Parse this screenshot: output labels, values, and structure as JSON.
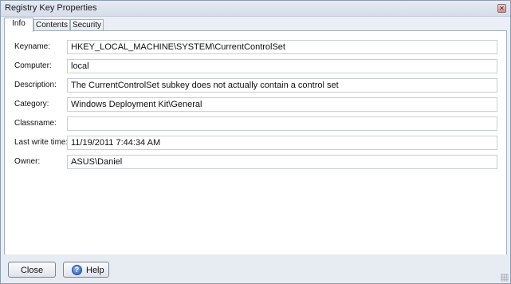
{
  "window": {
    "title": "Registry Key Properties"
  },
  "tabs": [
    {
      "label": "Info",
      "active": true
    },
    {
      "label": "Contents",
      "active": false
    },
    {
      "label": "Security",
      "active": false
    }
  ],
  "fields": [
    {
      "label": "Keyname:",
      "value": "HKEY_LOCAL_MACHINE\\SYSTEM\\CurrentControlSet"
    },
    {
      "label": "Computer:",
      "value": "local"
    },
    {
      "label": "Description:",
      "value": "The CurrentControlSet subkey does not actually contain a control set"
    },
    {
      "label": "Category:",
      "value": "Windows Deployment Kit\\General"
    },
    {
      "label": "Classname:",
      "value": ""
    },
    {
      "label": "Last write time:",
      "value": "11/19/2011 7:44:34 AM"
    },
    {
      "label": "Owner:",
      "value": "ASUS\\Daniel"
    }
  ],
  "footer": {
    "close_label": "Close",
    "help_label": "Help"
  },
  "icons": {
    "close": "close-x-icon",
    "help": "help-question-icon",
    "grip": "resize-grip-icon"
  },
  "colors": {
    "panel_bg": "#ffffff",
    "window_bg": "#eaeef5",
    "border": "#a6b0c0"
  }
}
